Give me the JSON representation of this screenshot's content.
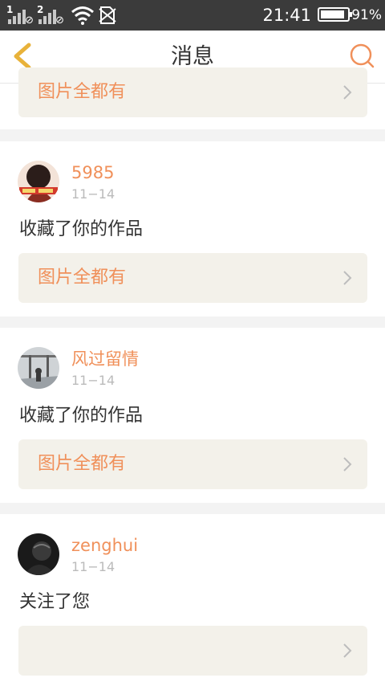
{
  "status_bar": {
    "sim1_label": "1",
    "sim2_label": "2",
    "time": "21:41",
    "battery": "91%",
    "battery_level": 0.91
  },
  "header": {
    "title": "消息",
    "back_icon": "chevron-left-icon",
    "search_icon": "search-icon",
    "accent_color": "#e8b23a"
  },
  "notifications": [
    {
      "user": "",
      "date": "",
      "action": "",
      "work_title": "图片全都有"
    },
    {
      "user": "5985",
      "date": "11−14",
      "action": "收藏了你的作品",
      "work_title": "图片全都有"
    },
    {
      "user": "风过留情",
      "date": "11−14",
      "action": "收藏了你的作品",
      "work_title": "图片全都有"
    },
    {
      "user": "zenghui",
      "date": "11−14",
      "action": "关注了您",
      "work_title": ""
    }
  ],
  "colors": {
    "username": "#f0905a",
    "work_title": "#f0905a",
    "work_bg": "#f3f1ea",
    "status_bar": "#3b3b3b"
  }
}
